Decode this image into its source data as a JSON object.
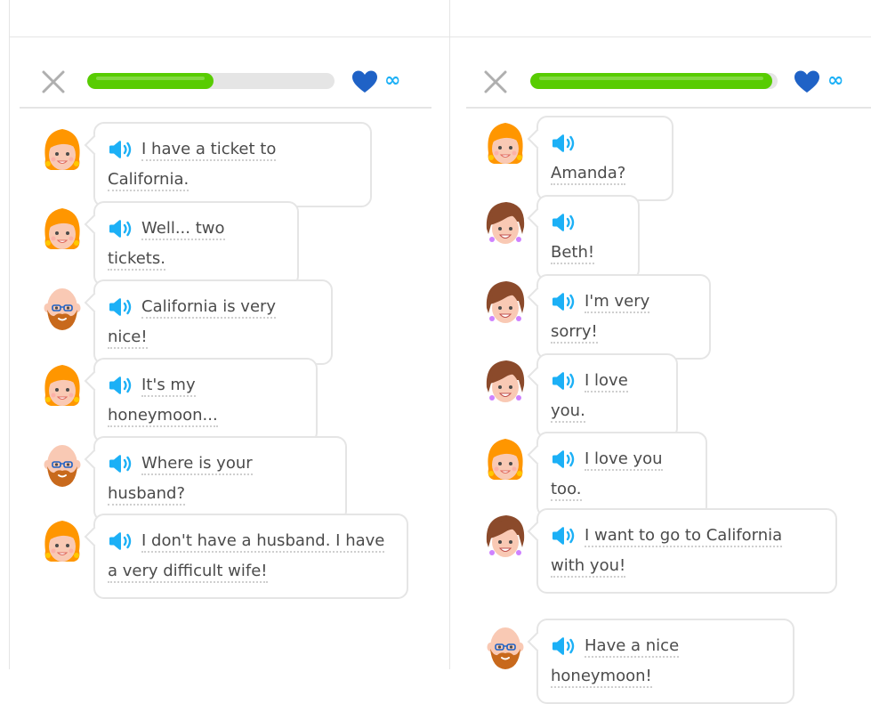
{
  "colors": {
    "progress_fill": "#58cc02",
    "progress_track": "#e5e5e5",
    "heart": "#1f62c6",
    "speaker": "#1cb0f6",
    "border": "#e5e5e5",
    "text": "#4b4b4b"
  },
  "icons": {
    "close": "close-icon",
    "heart": "heart-icon",
    "speaker": "speaker-icon"
  },
  "left": {
    "progress": 0.51,
    "hearts_label": "∞",
    "messages": [
      {
        "speaker": "woman-orange-hair",
        "text": "I have a ticket to California."
      },
      {
        "speaker": "woman-orange-hair",
        "text": "Well... two tickets."
      },
      {
        "speaker": "bald-bearded-man",
        "text": "California is very nice!"
      },
      {
        "speaker": "woman-orange-hair",
        "text": "It's my honeymoon..."
      },
      {
        "speaker": "bald-bearded-man",
        "text": "Where is your husband?"
      },
      {
        "speaker": "woman-orange-hair",
        "text": "I don't have a husband. I have a very difficult wife!"
      }
    ]
  },
  "right": {
    "progress": 0.98,
    "hearts_label": "∞",
    "messages": [
      {
        "speaker": "woman-orange-hair",
        "text": "Amanda?"
      },
      {
        "speaker": "woman-brown-hair",
        "text": "Beth!"
      },
      {
        "speaker": "woman-brown-hair",
        "text": "I'm very sorry!"
      },
      {
        "speaker": "woman-brown-hair",
        "text": "I love you."
      },
      {
        "speaker": "woman-orange-hair",
        "text": "I love you too."
      },
      {
        "speaker": "woman-brown-hair",
        "text": "I want to go to California with you!"
      },
      {
        "speaker": "bald-bearded-man",
        "text": "Have a nice honeymoon!"
      }
    ]
  }
}
